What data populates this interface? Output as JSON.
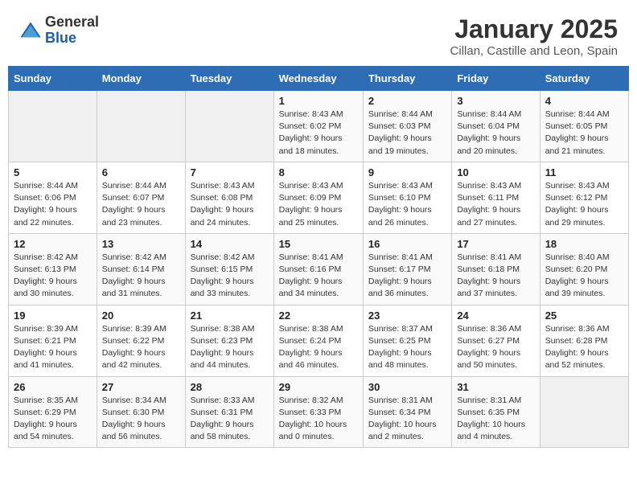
{
  "logo": {
    "general": "General",
    "blue": "Blue"
  },
  "title": "January 2025",
  "subtitle": "Cillan, Castille and Leon, Spain",
  "days_header": [
    "Sunday",
    "Monday",
    "Tuesday",
    "Wednesday",
    "Thursday",
    "Friday",
    "Saturday"
  ],
  "weeks": [
    [
      {
        "num": "",
        "info": ""
      },
      {
        "num": "",
        "info": ""
      },
      {
        "num": "",
        "info": ""
      },
      {
        "num": "1",
        "info": "Sunrise: 8:43 AM\nSunset: 6:02 PM\nDaylight: 9 hours and 18 minutes."
      },
      {
        "num": "2",
        "info": "Sunrise: 8:44 AM\nSunset: 6:03 PM\nDaylight: 9 hours and 19 minutes."
      },
      {
        "num": "3",
        "info": "Sunrise: 8:44 AM\nSunset: 6:04 PM\nDaylight: 9 hours and 20 minutes."
      },
      {
        "num": "4",
        "info": "Sunrise: 8:44 AM\nSunset: 6:05 PM\nDaylight: 9 hours and 21 minutes."
      }
    ],
    [
      {
        "num": "5",
        "info": "Sunrise: 8:44 AM\nSunset: 6:06 PM\nDaylight: 9 hours and 22 minutes."
      },
      {
        "num": "6",
        "info": "Sunrise: 8:44 AM\nSunset: 6:07 PM\nDaylight: 9 hours and 23 minutes."
      },
      {
        "num": "7",
        "info": "Sunrise: 8:43 AM\nSunset: 6:08 PM\nDaylight: 9 hours and 24 minutes."
      },
      {
        "num": "8",
        "info": "Sunrise: 8:43 AM\nSunset: 6:09 PM\nDaylight: 9 hours and 25 minutes."
      },
      {
        "num": "9",
        "info": "Sunrise: 8:43 AM\nSunset: 6:10 PM\nDaylight: 9 hours and 26 minutes."
      },
      {
        "num": "10",
        "info": "Sunrise: 8:43 AM\nSunset: 6:11 PM\nDaylight: 9 hours and 27 minutes."
      },
      {
        "num": "11",
        "info": "Sunrise: 8:43 AM\nSunset: 6:12 PM\nDaylight: 9 hours and 29 minutes."
      }
    ],
    [
      {
        "num": "12",
        "info": "Sunrise: 8:42 AM\nSunset: 6:13 PM\nDaylight: 9 hours and 30 minutes."
      },
      {
        "num": "13",
        "info": "Sunrise: 8:42 AM\nSunset: 6:14 PM\nDaylight: 9 hours and 31 minutes."
      },
      {
        "num": "14",
        "info": "Sunrise: 8:42 AM\nSunset: 6:15 PM\nDaylight: 9 hours and 33 minutes."
      },
      {
        "num": "15",
        "info": "Sunrise: 8:41 AM\nSunset: 6:16 PM\nDaylight: 9 hours and 34 minutes."
      },
      {
        "num": "16",
        "info": "Sunrise: 8:41 AM\nSunset: 6:17 PM\nDaylight: 9 hours and 36 minutes."
      },
      {
        "num": "17",
        "info": "Sunrise: 8:41 AM\nSunset: 6:18 PM\nDaylight: 9 hours and 37 minutes."
      },
      {
        "num": "18",
        "info": "Sunrise: 8:40 AM\nSunset: 6:20 PM\nDaylight: 9 hours and 39 minutes."
      }
    ],
    [
      {
        "num": "19",
        "info": "Sunrise: 8:39 AM\nSunset: 6:21 PM\nDaylight: 9 hours and 41 minutes."
      },
      {
        "num": "20",
        "info": "Sunrise: 8:39 AM\nSunset: 6:22 PM\nDaylight: 9 hours and 42 minutes."
      },
      {
        "num": "21",
        "info": "Sunrise: 8:38 AM\nSunset: 6:23 PM\nDaylight: 9 hours and 44 minutes."
      },
      {
        "num": "22",
        "info": "Sunrise: 8:38 AM\nSunset: 6:24 PM\nDaylight: 9 hours and 46 minutes."
      },
      {
        "num": "23",
        "info": "Sunrise: 8:37 AM\nSunset: 6:25 PM\nDaylight: 9 hours and 48 minutes."
      },
      {
        "num": "24",
        "info": "Sunrise: 8:36 AM\nSunset: 6:27 PM\nDaylight: 9 hours and 50 minutes."
      },
      {
        "num": "25",
        "info": "Sunrise: 8:36 AM\nSunset: 6:28 PM\nDaylight: 9 hours and 52 minutes."
      }
    ],
    [
      {
        "num": "26",
        "info": "Sunrise: 8:35 AM\nSunset: 6:29 PM\nDaylight: 9 hours and 54 minutes."
      },
      {
        "num": "27",
        "info": "Sunrise: 8:34 AM\nSunset: 6:30 PM\nDaylight: 9 hours and 56 minutes."
      },
      {
        "num": "28",
        "info": "Sunrise: 8:33 AM\nSunset: 6:31 PM\nDaylight: 9 hours and 58 minutes."
      },
      {
        "num": "29",
        "info": "Sunrise: 8:32 AM\nSunset: 6:33 PM\nDaylight: 10 hours and 0 minutes."
      },
      {
        "num": "30",
        "info": "Sunrise: 8:31 AM\nSunset: 6:34 PM\nDaylight: 10 hours and 2 minutes."
      },
      {
        "num": "31",
        "info": "Sunrise: 8:31 AM\nSunset: 6:35 PM\nDaylight: 10 hours and 4 minutes."
      },
      {
        "num": "",
        "info": ""
      }
    ]
  ]
}
